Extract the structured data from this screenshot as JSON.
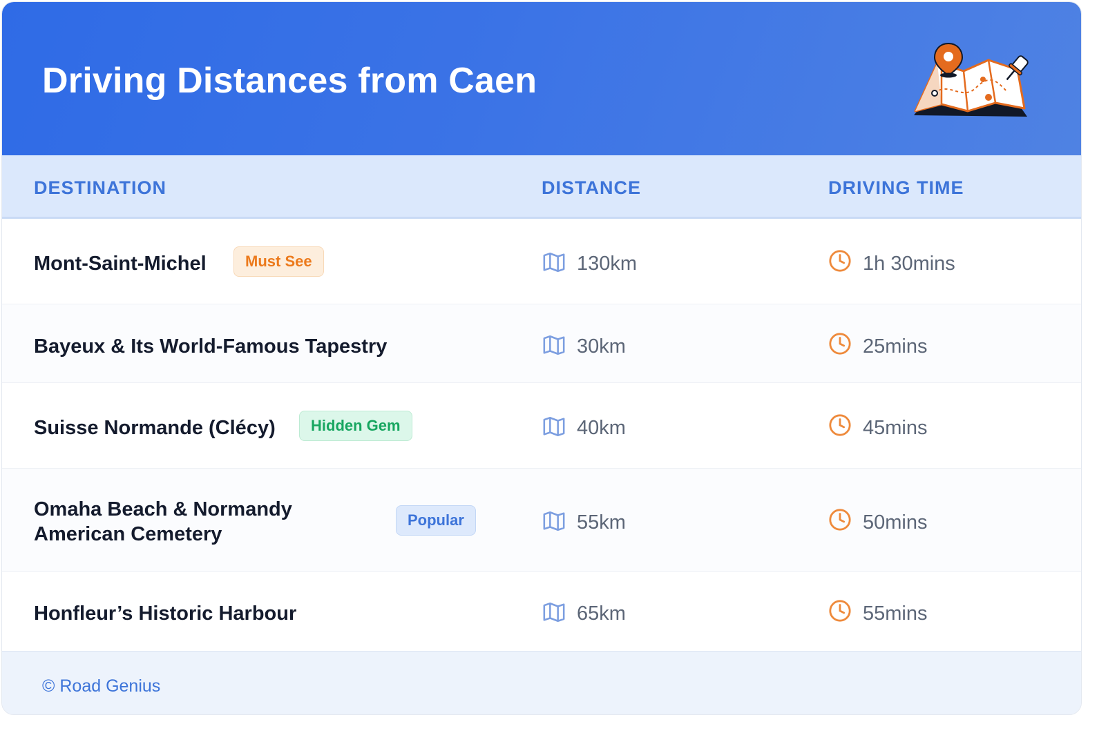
{
  "header": {
    "title": "Driving Distances from Caen"
  },
  "columns": {
    "destination": "DESTINATION",
    "distance": "DISTANCE",
    "driving_time": "DRIVING TIME"
  },
  "rows": [
    {
      "destination": "Mont-Saint-Michel",
      "badge": "Must See",
      "distance": "130km",
      "time": "1h 30mins"
    },
    {
      "destination": "Bayeux & Its World-Famous Tapestry",
      "badge": "",
      "distance": "30km",
      "time": "25mins"
    },
    {
      "destination": "Suisse Normande (Clécy)",
      "badge": "Hidden Gem",
      "distance": "40km",
      "time": "45mins"
    },
    {
      "destination_line1": "Omaha Beach & Normandy",
      "destination_line2": "American Cemetery",
      "badge": "Popular",
      "distance": "55km",
      "time": "50mins"
    },
    {
      "destination": "Honfleur’s Historic Harbour",
      "badge": "",
      "distance": "65km",
      "time": "55mins"
    }
  ],
  "footer": {
    "credit": "© Road Genius"
  },
  "colors": {
    "header_blue": "#2f6be6",
    "accent_blue": "#3d74d9",
    "orange": "#ec7a1c",
    "green": "#17a660"
  },
  "icons": {
    "distance": "map-icon",
    "time": "clock-icon",
    "header": "map-illustration"
  }
}
